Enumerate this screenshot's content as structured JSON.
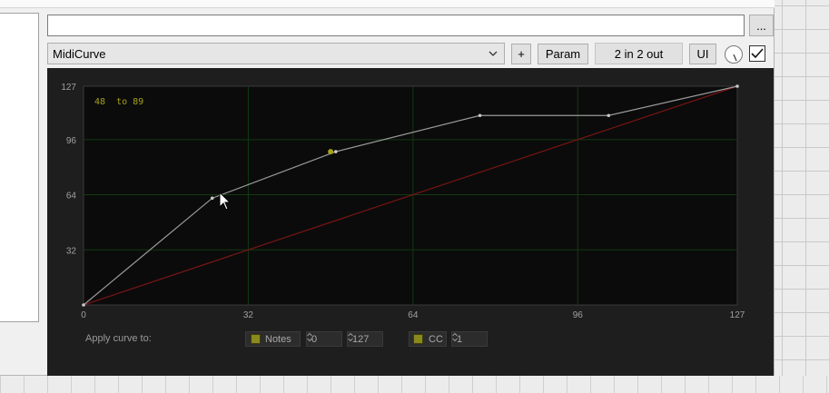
{
  "window": {
    "name_value": "",
    "browse_label": "...",
    "plugin_name": "MidiCurve",
    "add_label": "+",
    "param_label": "Param",
    "io_label": "2 in 2 out",
    "ui_label": "UI",
    "enabled": true
  },
  "curve": {
    "readout": "48  to 89",
    "x_range": [
      0,
      127
    ],
    "y_range": [
      0,
      127
    ],
    "x_ticks": [
      "0",
      "32",
      "64",
      "96",
      "127"
    ],
    "y_ticks": [
      "127",
      "96",
      "64",
      "32"
    ],
    "points": [
      [
        0,
        0
      ],
      [
        25,
        62
      ],
      [
        49,
        89
      ],
      [
        77,
        110
      ],
      [
        102,
        110
      ],
      [
        127,
        127
      ]
    ],
    "selected_point": [
      48,
      89
    ],
    "identity_color": "#7a1414",
    "curve_color": "#9a9a9a",
    "grid_color": "#123a12",
    "accent_color": "#a6a21a"
  },
  "controls": {
    "apply_label": "Apply curve to:",
    "notes_label": "Notes",
    "notes_min": "0",
    "notes_max": "127",
    "cc_label": "CC",
    "cc_number": "1"
  }
}
